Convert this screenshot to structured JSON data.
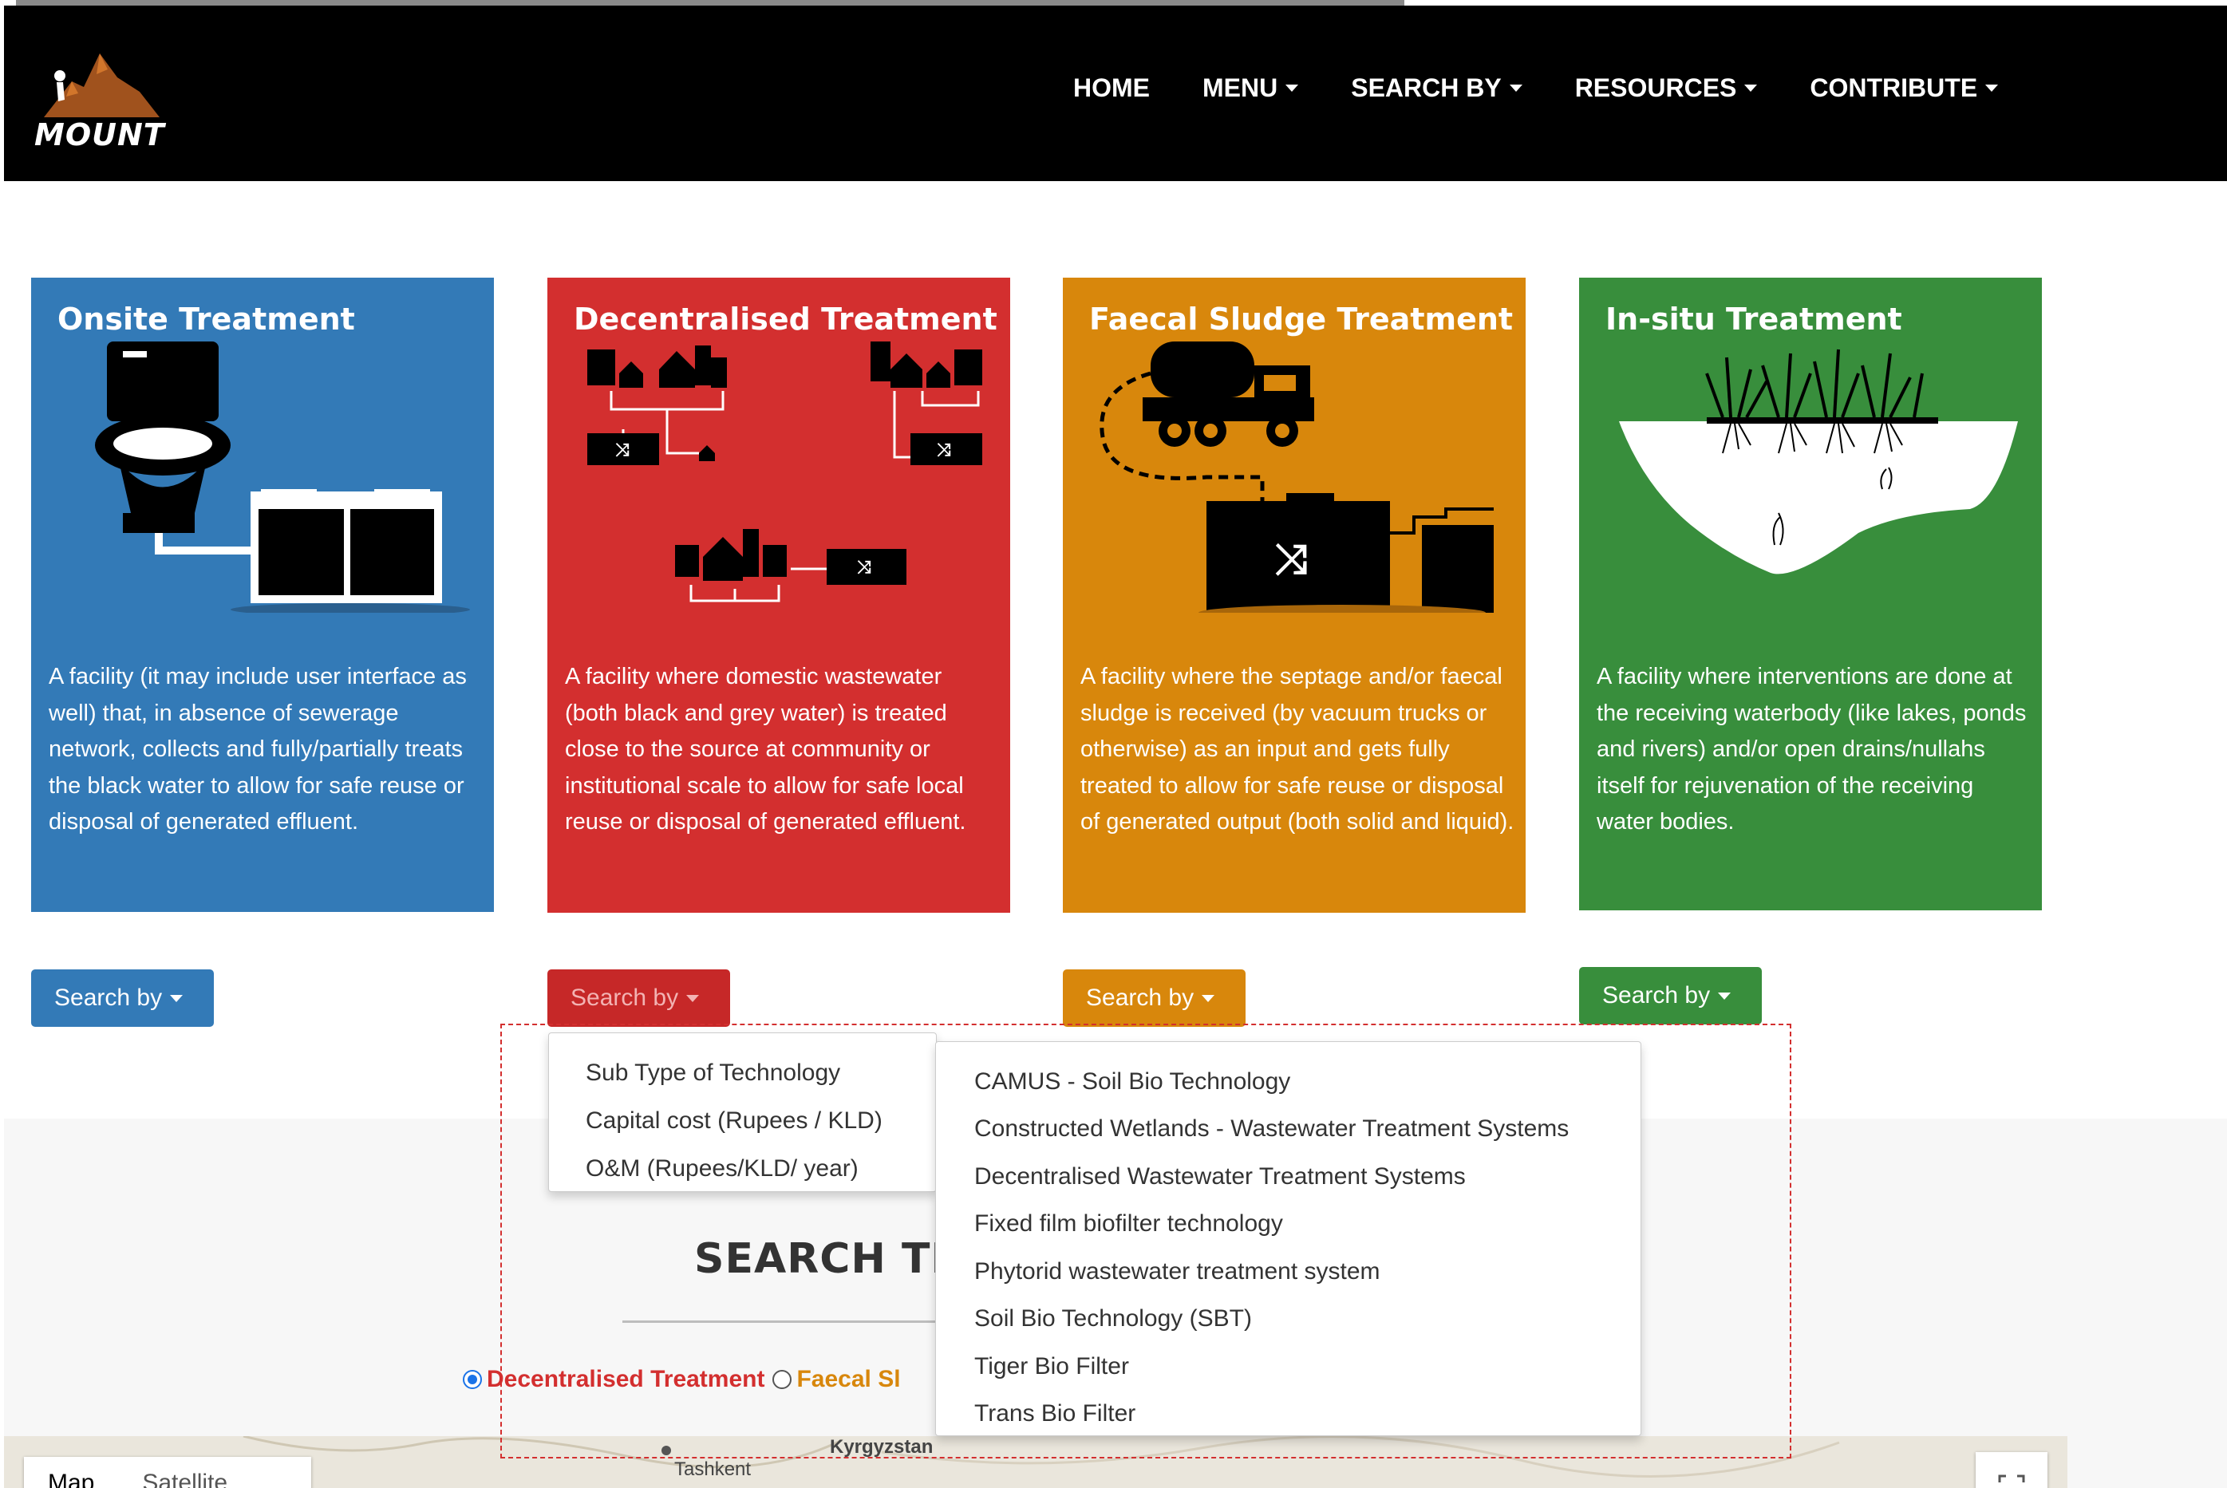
{
  "nav": {
    "logo_text": "MOUNT",
    "items": [
      {
        "label": "HOME",
        "has_caret": false
      },
      {
        "label": "MENU",
        "has_caret": true
      },
      {
        "label": "SEARCH BY",
        "has_caret": true
      },
      {
        "label": "RESOURCES",
        "has_caret": true
      },
      {
        "label": "CONTRIBUTE",
        "has_caret": true
      }
    ]
  },
  "cards": [
    {
      "title": "Onsite Treatment",
      "description": "A facility (it may include user interface as well) that, in absence of sewerage network, collects and fully/partially treats the black water to allow for safe reuse or disposal of generated effluent.",
      "button": "Search by",
      "color": "#337ab7"
    },
    {
      "title": "Decentralised Treatment",
      "description": "A facility where domestic wastewater (both black and grey water) is treated close to the source at community or institutional scale to allow for safe local reuse or disposal of generated effluent.",
      "button": "Search by",
      "color": "#d32f2f"
    },
    {
      "title": "Faecal Sludge Treatment",
      "description": "A facility where the septage and/or faecal sludge is received (by vacuum trucks or otherwise) as an input and gets fully treated to allow for safe reuse or disposal of generated output (both solid and liquid).",
      "button": "Search by",
      "color": "#d8870c"
    },
    {
      "title": "In-situ Treatment",
      "description": "A facility where interventions are done at the receiving waterbody (like lakes, ponds and rivers) and/or open drains/nullahs itself for rejuvenation of the receiving water bodies.",
      "button": "Search by",
      "color": "#388e3c"
    }
  ],
  "search_by_menu": {
    "options": [
      "Sub Type of Technology",
      "Capital cost (Rupees / KLD)",
      "O&M (Rupees/KLD/ year)"
    ]
  },
  "subtype_menu": {
    "options": [
      "CAMUS - Soil Bio Technology",
      "Constructed Wetlands - Wastewater Treatment Systems",
      "Decentralised Wastewater Treatment Systems",
      "Fixed film biofilter technology",
      "Phytorid wastewater treatment system",
      "Soil Bio Technology (SBT)",
      "Tiger Bio Filter",
      "Trans Bio Filter"
    ]
  },
  "search_section": {
    "heading": "SEARCH TE",
    "radio_decentralised": "Decentralised Treatment",
    "radio_faecal": "Faecal Sl"
  },
  "map": {
    "tab_map": "Map",
    "tab_satellite": "Satellite",
    "label_kyrgyzstan": "Kyrgyzstan",
    "label_tashkent": "Tashkent"
  }
}
